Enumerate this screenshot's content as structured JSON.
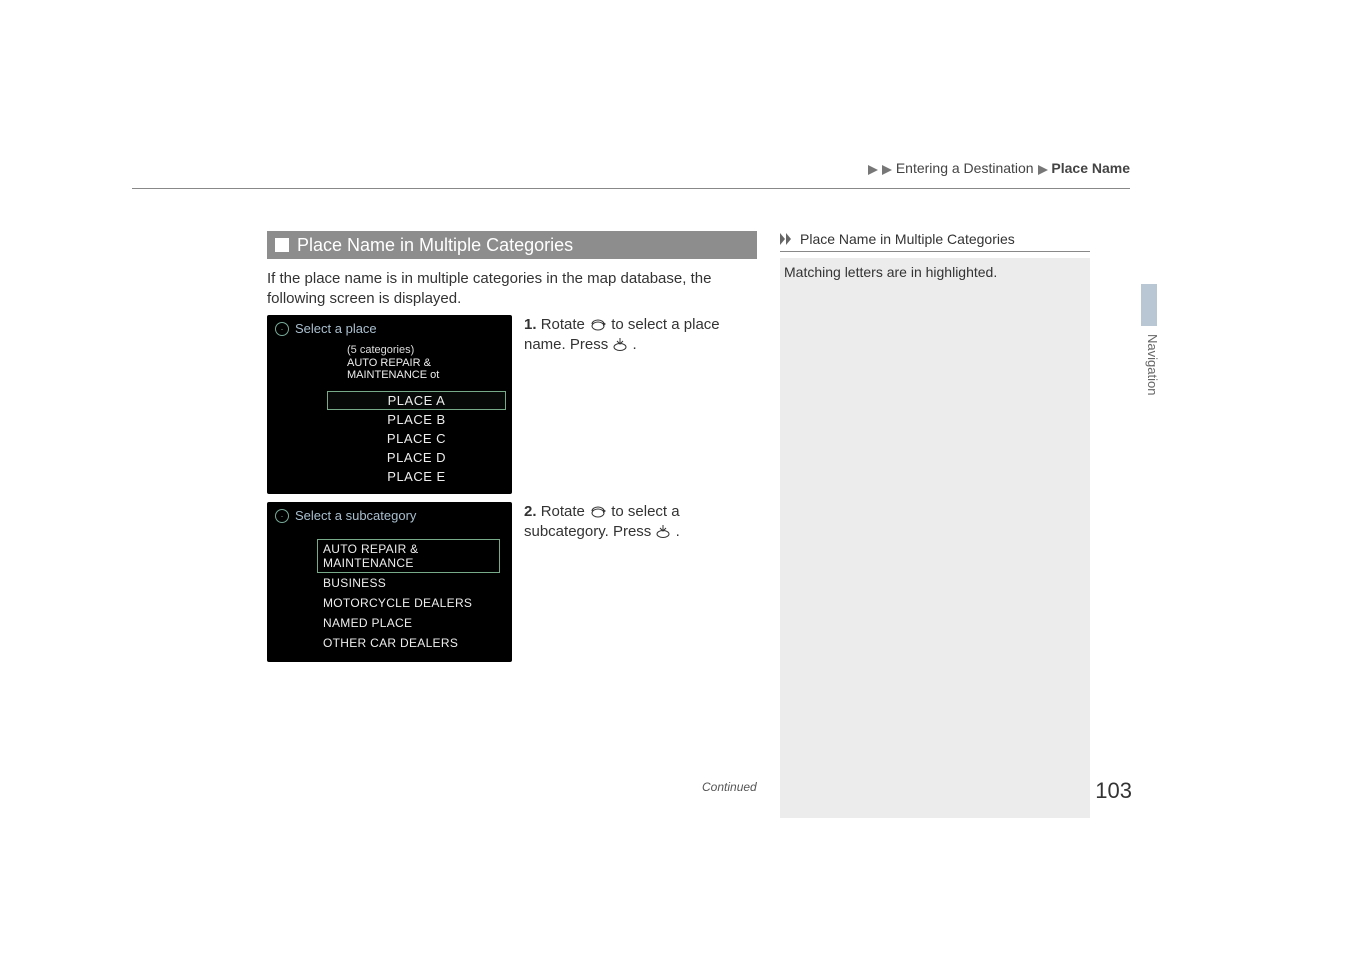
{
  "breadcrumb": {
    "section": "Entering a Destination",
    "page": "Place Name"
  },
  "vertLabel": "Navigation",
  "heading": "Place Name in Multiple Categories",
  "intro": "If the place name is in multiple categories in the map database, the following screen is displayed.",
  "screenshot1": {
    "title": "Select a place",
    "sub1": "(5 categories)",
    "sub2": "AUTO REPAIR & MAINTENANCE ot",
    "rows": [
      "PLACE A",
      "PLACE B",
      "PLACE C",
      "PLACE D",
      "PLACE E"
    ]
  },
  "screenshot2": {
    "title": "Select a subcategory",
    "rows": [
      "AUTO REPAIR & MAINTENANCE",
      "BUSINESS",
      "MOTORCYCLE DEALERS",
      "NAMED PLACE",
      "OTHER CAR DEALERS"
    ]
  },
  "step1": {
    "num": "1.",
    "textA": "Rotate ",
    "textB": " to select a place name. Press ",
    "textC": "."
  },
  "step2": {
    "num": "2.",
    "textA": "Rotate ",
    "textB": " to select a subcategory. Press ",
    "textC": "."
  },
  "sidebox": {
    "title": "Place Name in Multiple Categories",
    "body": "Matching letters are in highlighted."
  },
  "continued": "Continued",
  "pagenum": "103"
}
